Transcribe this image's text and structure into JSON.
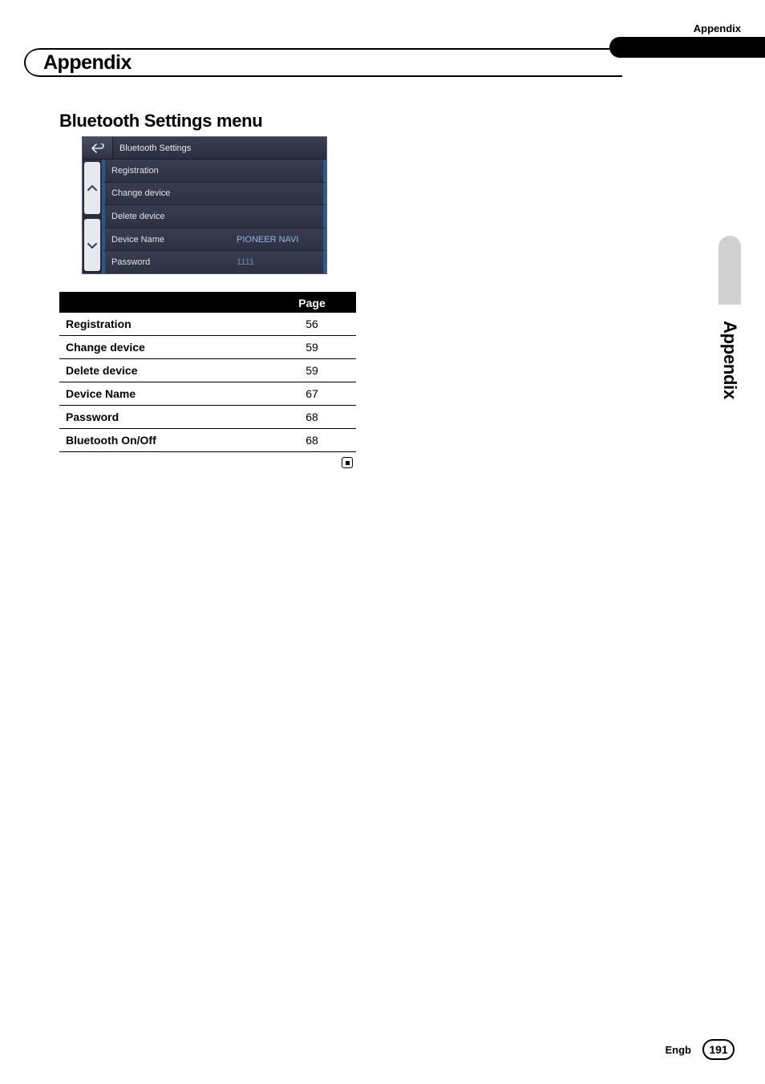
{
  "header": {
    "label": "Appendix"
  },
  "chapter": {
    "title": "Appendix"
  },
  "section": {
    "title": "Bluetooth Settings menu"
  },
  "screenshot": {
    "title": "Bluetooth Settings",
    "rows": [
      {
        "label": "Registration",
        "value": ""
      },
      {
        "label": "Change device",
        "value": ""
      },
      {
        "label": "Delete device",
        "value": ""
      },
      {
        "label": "Device Name",
        "value": "PIONEER NAVI"
      },
      {
        "label": "Password",
        "value": "1111"
      }
    ]
  },
  "refTable": {
    "headerPage": "Page",
    "rows": [
      {
        "name": "Registration",
        "page": "56"
      },
      {
        "name": "Change device",
        "page": "59"
      },
      {
        "name": "Delete device",
        "page": "59"
      },
      {
        "name": "Device Name",
        "page": "67"
      },
      {
        "name": "Password",
        "page": "68"
      },
      {
        "name": "Bluetooth On/Off",
        "page": "68"
      }
    ]
  },
  "sideTab": {
    "label": "Appendix"
  },
  "footer": {
    "lang": "Engb",
    "page": "191"
  }
}
